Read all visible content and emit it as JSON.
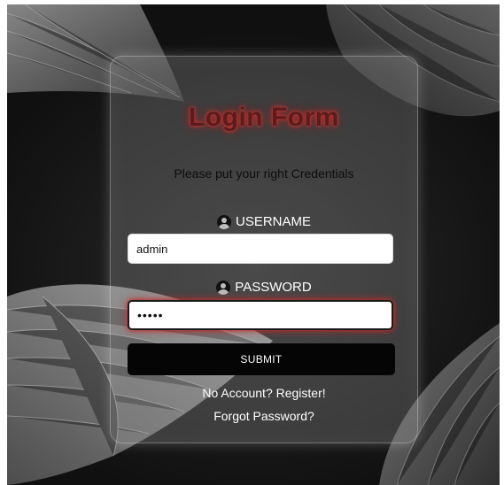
{
  "form": {
    "title": "Login Form",
    "subtitle": "Please put your right Credentials",
    "username_label": "USERNAME",
    "username_icon": "user-circle-icon",
    "username_value": "admin",
    "password_label": "PASSWORD",
    "password_icon": "user-lock-icon",
    "password_value": "•••••",
    "submit_label": "SUBMIT",
    "register_link": "No Account? Register!",
    "forgot_link": "Forgot Password?"
  },
  "colors": {
    "title_glow": "#c0302e",
    "card_bg": "rgba(150,150,150,0.30)",
    "submit_bg": "#050505"
  }
}
